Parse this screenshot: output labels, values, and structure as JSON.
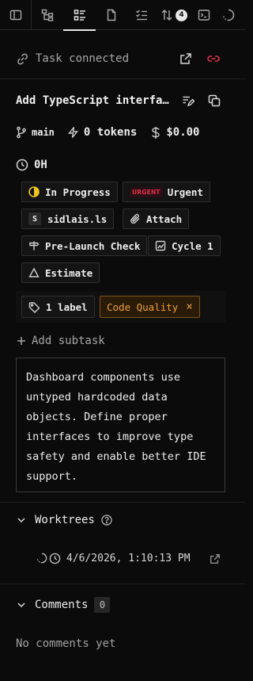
{
  "tabbar": {
    "tabs": [
      {
        "icon": "sidebar-icon"
      },
      {
        "icon": "tree-icon"
      },
      {
        "icon": "list-details-icon"
      },
      {
        "icon": "file-icon"
      },
      {
        "icon": "checklist-icon"
      },
      {
        "icon": "sort-arrows-icon",
        "count": "4"
      },
      {
        "icon": "terminal-icon"
      },
      {
        "icon": "loader-icon"
      }
    ]
  },
  "task": {
    "connection_status": "Task connected",
    "title": "Add TypeScript interfa…",
    "branch": "main",
    "tokens": "0 tokens",
    "cost": "$0.00",
    "time": "0H"
  },
  "chips": {
    "status": "In Progress",
    "priority_tag": "URGENT",
    "priority": "Urgent",
    "assignee_initial": "S",
    "assignee": "sidlais.ls",
    "attach": "Attach",
    "milestone": "Pre-Launch Check",
    "cycle": "Cycle 1",
    "estimate": "Estimate"
  },
  "labels": {
    "count": "1 label",
    "items": [
      "Code Quality"
    ],
    "remove_glyph": "×"
  },
  "add_subtask": "Add subtask",
  "description": "Dashboard components use untyped hardcoded data objects. Define proper interfaces to improve type safety and enable better IDE support.",
  "worktrees": {
    "title": "Worktrees",
    "timestamp": "4/6/2026, 1:10:13 PM"
  },
  "comments": {
    "title": "Comments",
    "count": "0",
    "empty": "No comments yet"
  },
  "colors": {
    "background": "#0b0b0b",
    "accent_red": "#e0304a",
    "label_orange": "#e8a33a",
    "status_yellow": "#f0c420"
  }
}
